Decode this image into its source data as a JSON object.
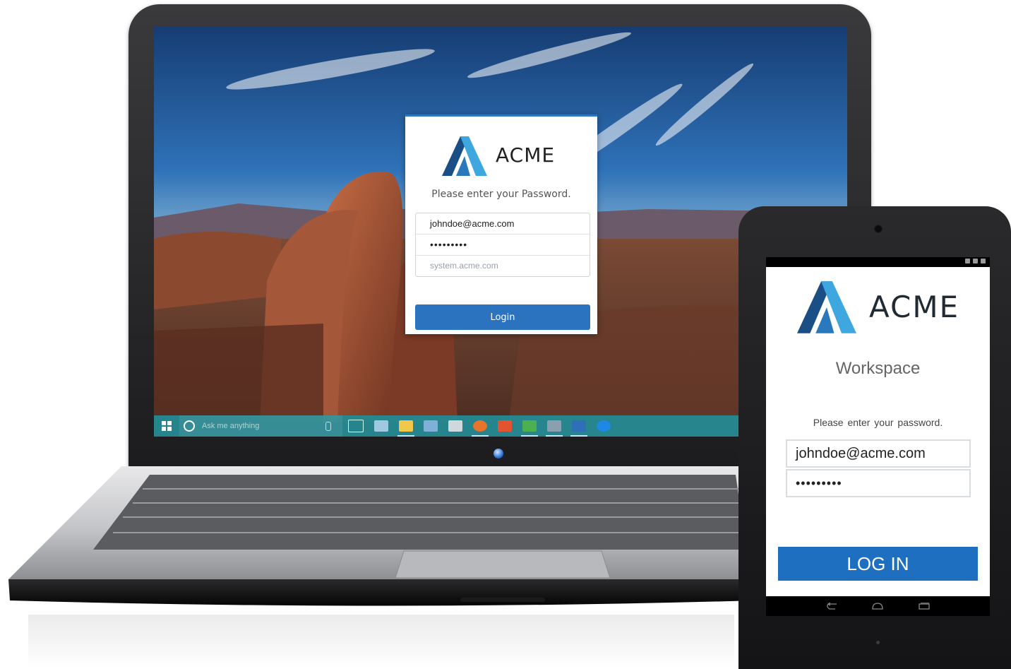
{
  "laptop": {
    "login_card": {
      "brand": "ACME",
      "prompt": "Please enter your Password.",
      "email_value": "johndoe@acme.com",
      "password_value": "•••••••••",
      "server_placeholder": "system.acme.com",
      "login_label": "Login"
    },
    "taskbar": {
      "search_placeholder": "Ask me anything",
      "icons": [
        "task-view-icon",
        "store-icon",
        "file-explorer-icon",
        "network-icon",
        "settings-icon",
        "firefox-icon",
        "media-icon",
        "xbox-icon",
        "photos-icon",
        "mail-icon",
        "edge-icon"
      ]
    }
  },
  "tablet": {
    "brand": "ACME",
    "subtitle": "Workspace",
    "prompt": "Please enter your password.",
    "email_value": "johndoe@acme.com",
    "password_value": "•••••••••",
    "login_label": "LOG IN"
  },
  "colors": {
    "accent_blue": "#2b73bf",
    "taskbar_teal": "#228c96",
    "logo_dark": "#1a4f86",
    "logo_light": "#3fa7e0"
  }
}
